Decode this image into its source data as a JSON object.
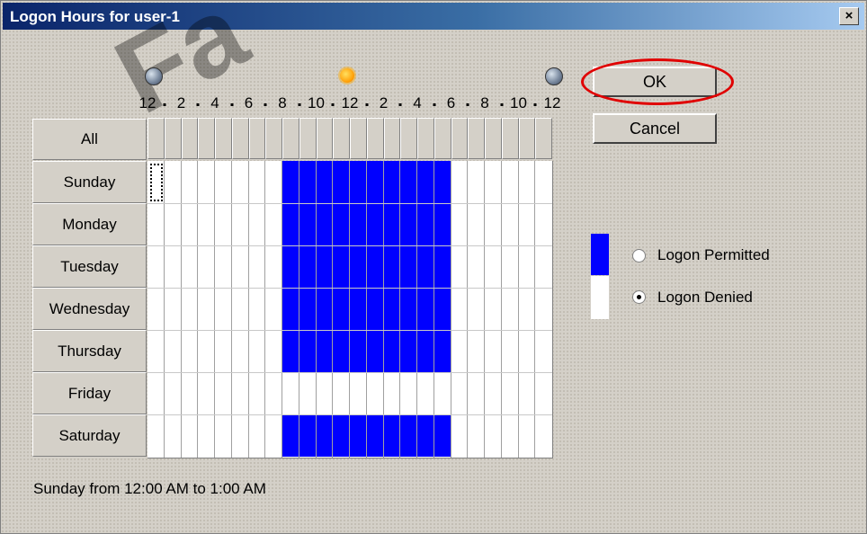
{
  "window": {
    "title": "Logon Hours for user-1",
    "close_glyph": "×"
  },
  "watermark": {
    "text": "Fa"
  },
  "time_axis": {
    "labels": [
      "12",
      "2",
      "4",
      "6",
      "8",
      "10",
      "12",
      "2",
      "4",
      "6",
      "8",
      "10",
      "12"
    ],
    "icons": [
      "moon-icon",
      "sun-icon",
      "moon-icon"
    ]
  },
  "grid": {
    "all_label": "All",
    "days": [
      "Sunday",
      "Monday",
      "Tuesday",
      "Wednesday",
      "Thursday",
      "Friday",
      "Saturday"
    ],
    "hours_per_day": 24,
    "permitted_hours": {
      "Sunday": [
        8,
        17
      ],
      "Monday": [
        8,
        17
      ],
      "Tuesday": [
        8,
        17
      ],
      "Wednesday": [
        8,
        17
      ],
      "Thursday": [
        8,
        17
      ],
      "Friday": [],
      "Saturday": [
        8,
        17
      ]
    },
    "permitted_color": "#0000ff",
    "denied_color": "#ffffff"
  },
  "buttons": {
    "ok_label": "OK",
    "cancel_label": "Cancel"
  },
  "legend": {
    "permitted_label": "Logon Permitted",
    "denied_label": "Logon Denied",
    "selected": "denied"
  },
  "status": {
    "text": "Sunday from 12:00 AM to 1:00 AM"
  }
}
